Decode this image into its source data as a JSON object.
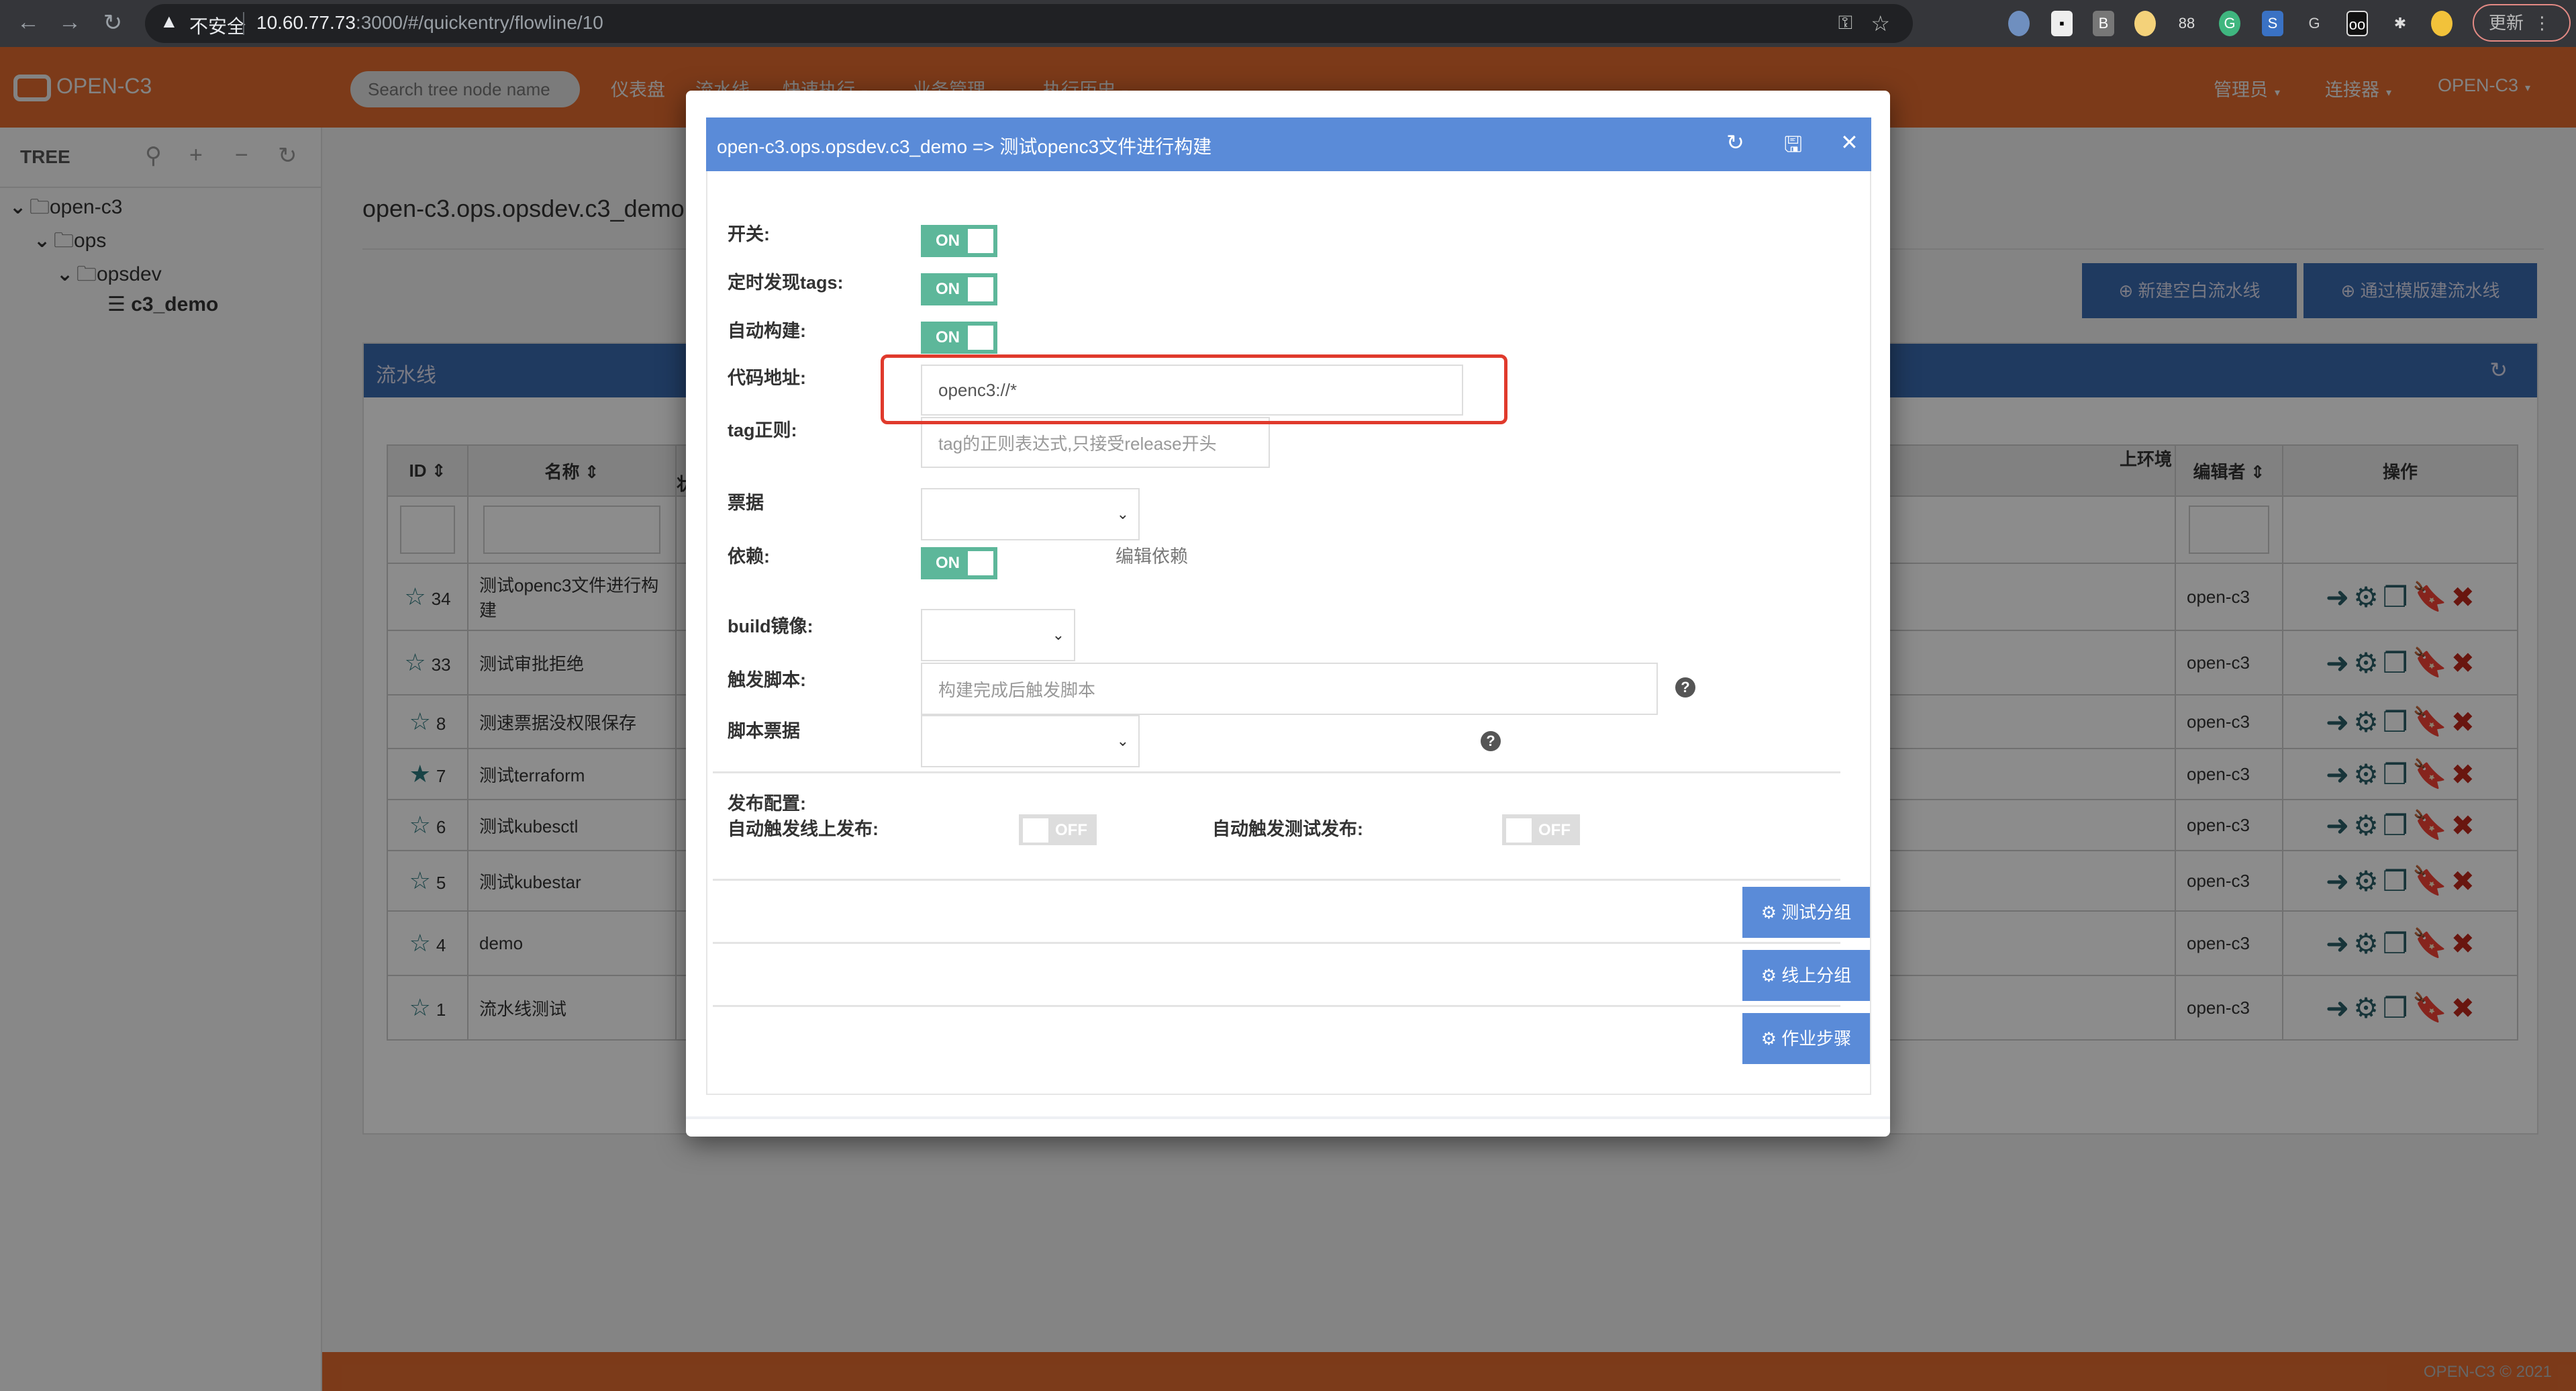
{
  "browser": {
    "security_label": "不安全",
    "url_host": "10.60.77.73",
    "url_path": ":3000/#/quickentry/flowline/10",
    "update_label": "更新",
    "extensions": [
      "O",
      "S",
      "B",
      "",
      "88",
      "G",
      "S",
      "G",
      "oo",
      "puzzle",
      ""
    ]
  },
  "topnav": {
    "logo_text": "OPEN-C3",
    "search_placeholder": "Search tree node name",
    "menu": [
      {
        "label": "仪表盘"
      },
      {
        "label": "流水线"
      },
      {
        "label": "快速执行"
      },
      {
        "label": "业务管理"
      },
      {
        "label": "执行历史"
      }
    ],
    "right_menu": [
      {
        "label": "管理员"
      },
      {
        "label": "连接器"
      },
      {
        "label": "OPEN-C3"
      }
    ]
  },
  "sidebar": {
    "title": "TREE",
    "nodes": [
      {
        "label": "open-c3",
        "depth": 0
      },
      {
        "label": "ops",
        "depth": 1
      },
      {
        "label": "opsdev",
        "depth": 2
      },
      {
        "label": "c3_demo",
        "depth": 3,
        "selected": true
      }
    ]
  },
  "content": {
    "title": "open-c3.ops.opsdev.c3_demo",
    "new_blank_label": "新建空白流水线",
    "new_template_label": "通过模版建流水线",
    "panel_title": "流水线",
    "table": {
      "headers": {
        "id": "ID",
        "name": "名称",
        "env_status": "上环境状态",
        "editor": "编辑者",
        "actions": "操作"
      },
      "rows": [
        {
          "id": "34",
          "name": "测试openc3文件进行构建",
          "editor": "open-c3",
          "starred": false
        },
        {
          "id": "33",
          "name": "测试审批拒绝",
          "editor": "open-c3",
          "starred": false
        },
        {
          "id": "8",
          "name": "测速票据没权限保存",
          "editor": "open-c3",
          "starred": false
        },
        {
          "id": "7",
          "name": "测试terraform",
          "editor": "open-c3",
          "starred": true
        },
        {
          "id": "6",
          "name": "测试kubesctl",
          "editor": "open-c3",
          "starred": false
        },
        {
          "id": "5",
          "name": "测试kubestar",
          "editor": "open-c3",
          "starred": false
        },
        {
          "id": "4",
          "name": "demo",
          "editor": "open-c3",
          "starred": false
        },
        {
          "id": "1",
          "name": "流水线测试",
          "editor": "open-c3",
          "starred": false
        }
      ]
    }
  },
  "footer": {
    "text": "OPEN-C3 © 2021"
  },
  "modal": {
    "title": "open-c3.ops.opsdev.c3_demo => 测试openc3文件进行构建",
    "fields": {
      "switch_label": "开关:",
      "switch_value": "ON",
      "tag_discover_label": "定时发现tags:",
      "tag_discover_value": "ON",
      "auto_build_label": "自动构建:",
      "auto_build_value": "ON",
      "code_addr_label": "代码地址:",
      "code_addr_value": "openc3://*",
      "tag_regex_label": "tag正则:",
      "tag_regex_placeholder": "tag的正则表达式,只接受release开头",
      "ticket_label": "票据",
      "ticket_value": "",
      "dependency_label": "依赖:",
      "dependency_value": "ON",
      "edit_dependency_label": "编辑依赖",
      "build_image_label": "build镜像:",
      "build_image_value": "",
      "trigger_script_label": "触发脚本:",
      "trigger_script_placeholder": "构建完成后触发脚本",
      "script_ticket_label": "脚本票据",
      "script_ticket_value": "",
      "publish_config_label": "发布配置:",
      "auto_online_label": "自动触发线上发布:",
      "auto_online_value": "OFF",
      "auto_test_label": "自动触发测试发布:",
      "auto_test_value": "OFF"
    },
    "buttons": {
      "test_group": "测试分组",
      "online_group": "线上分组",
      "job_steps": "作业步骤"
    }
  }
}
